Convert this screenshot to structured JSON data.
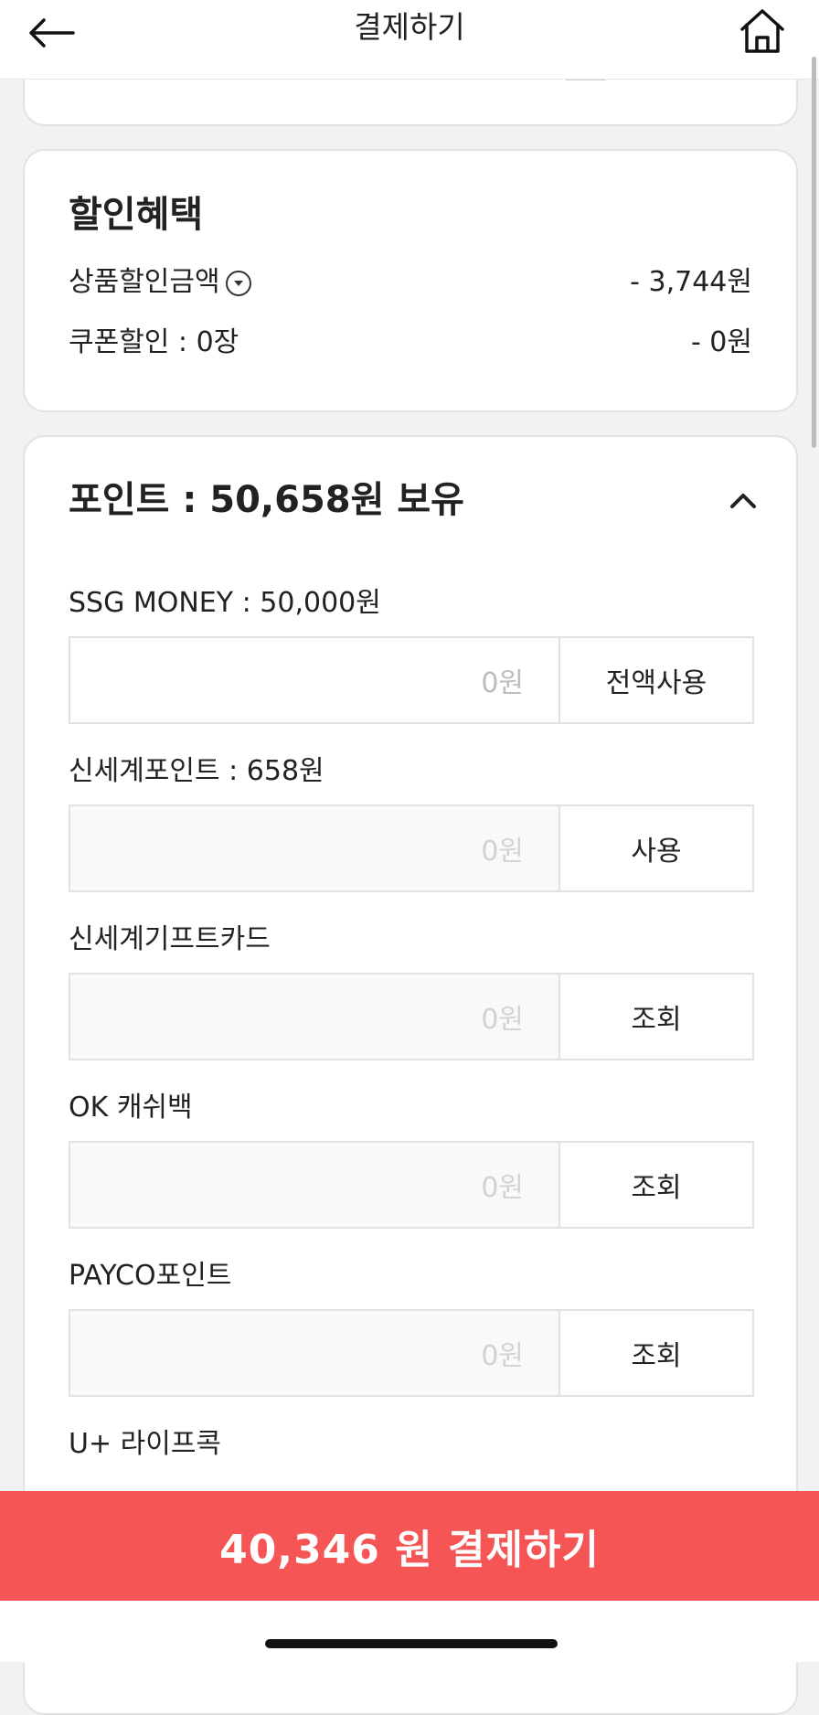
{
  "header": {
    "title": "결제하기",
    "back_icon": "arrow-left-icon",
    "home_icon": "home-icon"
  },
  "discount": {
    "title": "할인혜택",
    "product_discount_label": "상품할인금액",
    "product_discount_value": "- 3,744원",
    "coupon_label": "쿠폰할인 : 0장",
    "coupon_value": "- 0원"
  },
  "points": {
    "title": "포인트 : 50,658원 보유",
    "fields": [
      {
        "label": "SSG MONEY : 50,000원",
        "placeholder": "0원",
        "button": "전액사용"
      },
      {
        "label": "신세계포인트 : 658원",
        "placeholder": "0원",
        "button": "사용"
      },
      {
        "label": "신세계기프트카드",
        "placeholder": "0원",
        "button": "조회"
      },
      {
        "label": "OK 캐쉬백",
        "placeholder": "0원",
        "button": "조회"
      },
      {
        "label": "PAYCO포인트",
        "placeholder": "0원",
        "button": "조회"
      },
      {
        "label": "U+ 라이프콕"
      }
    ]
  },
  "pay_button": {
    "label": "40,346 원 결제하기"
  },
  "colors": {
    "accent": "#f55555",
    "card_border": "#e2e2e2",
    "background": "#f3f2f2"
  }
}
